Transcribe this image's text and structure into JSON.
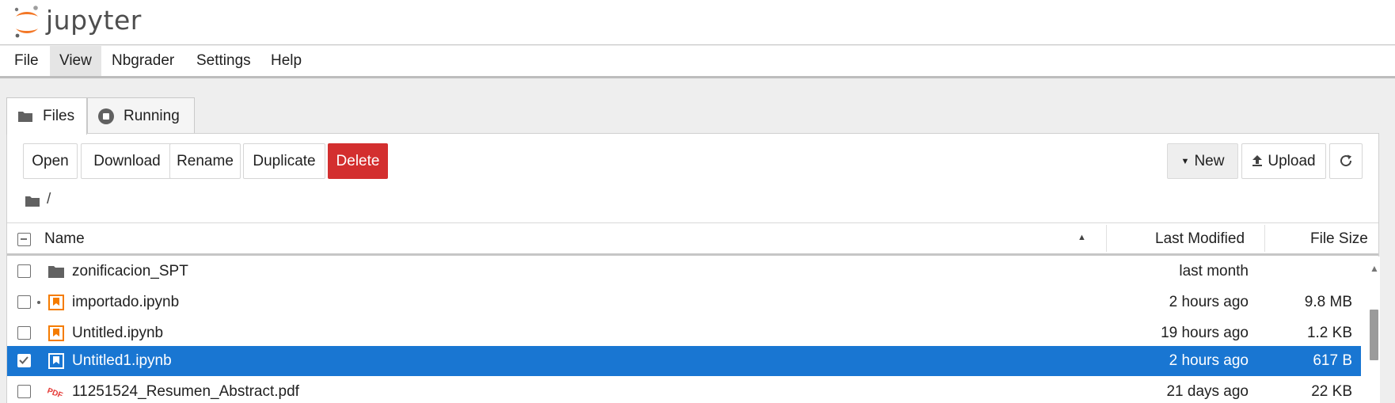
{
  "app": {
    "logo_text": "jupyter"
  },
  "menubar": {
    "items": [
      {
        "label": "File"
      },
      {
        "label": "View"
      },
      {
        "label": "Nbgrader"
      },
      {
        "label": "Settings"
      },
      {
        "label": "Help"
      }
    ]
  },
  "tabs": [
    {
      "label": "Files",
      "icon": "folder-icon",
      "active": true
    },
    {
      "label": "Running",
      "icon": "stop-circle-icon",
      "active": false
    }
  ],
  "toolbar": {
    "open_label": "Open",
    "download_label": "Download",
    "rename_label": "Rename",
    "duplicate_label": "Duplicate",
    "delete_label": "Delete",
    "new_label": "New",
    "upload_label": "Upload",
    "delete_color": "#d32f2f"
  },
  "breadcrumb": {
    "path": "/"
  },
  "list": {
    "headers": {
      "name": "Name",
      "last_modified": "Last Modified",
      "file_size": "File Size"
    },
    "sort": {
      "column": "Name",
      "direction": "ascending"
    },
    "rows": [
      {
        "name": "zonificacion_SPT",
        "type": "folder",
        "icon": "folder-icon",
        "modified": "last month",
        "size": "",
        "selected": false,
        "running": false
      },
      {
        "name": "importado.ipynb",
        "type": "notebook",
        "icon": "notebook-icon",
        "modified": "2 hours ago",
        "size": "9.8 MB",
        "selected": false,
        "running": true
      },
      {
        "name": "Untitled.ipynb",
        "type": "notebook",
        "icon": "notebook-icon",
        "modified": "19 hours ago",
        "size": "1.2 KB",
        "selected": false,
        "running": false
      },
      {
        "name": "Untitled1.ipynb",
        "type": "notebook",
        "icon": "notebook-icon",
        "modified": "2 hours ago",
        "size": "617 B",
        "selected": true,
        "running": false
      },
      {
        "name": "11251524_Resumen_Abstract.pdf",
        "type": "pdf",
        "icon": "pdf-icon",
        "modified": "21 days ago",
        "size": "22 KB",
        "selected": false,
        "running": false
      }
    ]
  },
  "colors": {
    "selection": "#1976d2",
    "notebook_icon": "#f57c00",
    "pdf_icon": "#e53935",
    "logo_orange": "#f37726"
  }
}
